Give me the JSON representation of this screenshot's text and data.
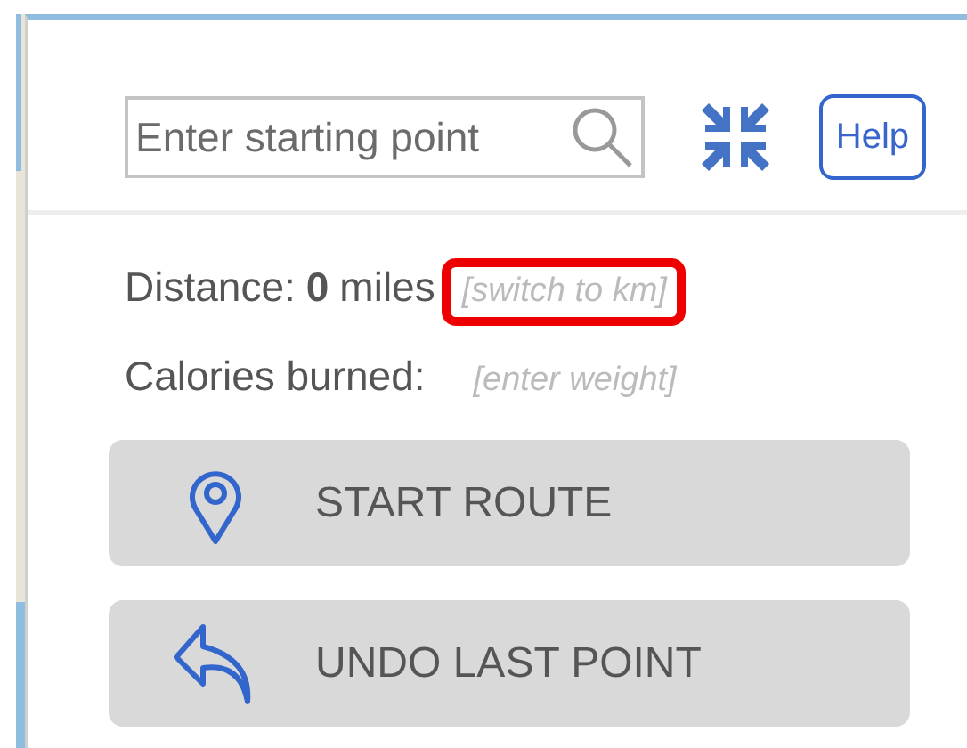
{
  "search": {
    "placeholder": "Enter starting point"
  },
  "help_button": {
    "label": "Help"
  },
  "distance": {
    "label": "Distance:",
    "value": "0",
    "unit": "miles",
    "link": {
      "label": "[switch to km]",
      "highlighted": true
    }
  },
  "calories": {
    "label": "Calories burned:",
    "link": {
      "label": "[enter weight]",
      "highlighted": false
    }
  },
  "buttons": [
    {
      "kind": "start",
      "label": "START ROUTE"
    },
    {
      "kind": "undo",
      "label": "UNDO LAST POINT"
    }
  ]
}
